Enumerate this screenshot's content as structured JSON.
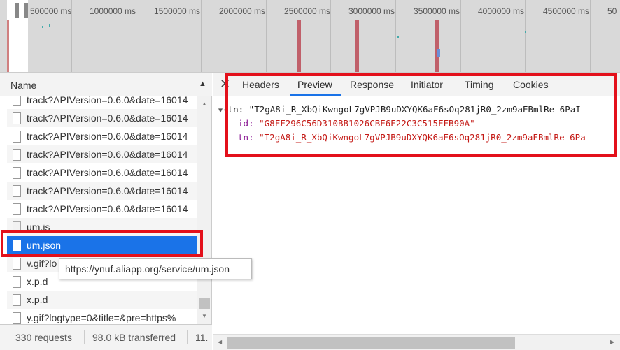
{
  "timeline": {
    "ticks": [
      "500000 ms",
      "1000000 ms",
      "1500000 ms",
      "2000000 ms",
      "2500000 ms",
      "3000000 ms",
      "3500000 ms",
      "4000000 ms",
      "4500000 ms",
      "50"
    ]
  },
  "requests_panel": {
    "header": {
      "name_column": "Name"
    },
    "items": [
      {
        "name": "track?APIVersion=0.6.0&date=16014",
        "icon": "document-icon"
      },
      {
        "name": "track?APIVersion=0.6.0&date=16014",
        "icon": "document-icon"
      },
      {
        "name": "track?APIVersion=0.6.0&date=16014",
        "icon": "document-icon"
      },
      {
        "name": "track?APIVersion=0.6.0&date=16014",
        "icon": "document-icon"
      },
      {
        "name": "track?APIVersion=0.6.0&date=16014",
        "icon": "document-icon"
      },
      {
        "name": "track?APIVersion=0.6.0&date=16014",
        "icon": "document-icon"
      },
      {
        "name": "track?APIVersion=0.6.0&date=16014",
        "icon": "document-icon"
      },
      {
        "name": "um.js",
        "icon": "script-icon"
      },
      {
        "name": "um.json",
        "icon": "document-icon",
        "selected": true
      },
      {
        "name": "v.gif?lo",
        "icon": "document-icon"
      },
      {
        "name": "x.p.d",
        "icon": "document-icon"
      },
      {
        "name": "x.p.d",
        "icon": "document-icon"
      },
      {
        "name": "y.gif?logtype=0&title=&pre=https%",
        "icon": "document-icon"
      }
    ],
    "tooltip": "https://ynuf.aliapp.org/service/um.json",
    "status": {
      "requests": "330 requests",
      "transferred": "98.0 kB transferred",
      "extra": "11."
    }
  },
  "details_panel": {
    "tabs": [
      "Headers",
      "Preview",
      "Response",
      "Initiator",
      "Timing",
      "Cookies"
    ],
    "active_tab": "Preview",
    "preview": {
      "summary_prefix": "{tn: ",
      "summary_value": "\"T2gA8i_R_XbQiKwngoL7gVPJB9uDXYQK6aE6sOq281jR0_2zm9aEBmlRe-6PaI",
      "fields": [
        {
          "key": "id",
          "value": "\"G8FF296C56D310BB1026CBE6E22C3C515FFB90A\""
        },
        {
          "key": "tn",
          "value": "\"T2gA8i_R_XbQiKwngoL7gVPJB9uDXYQK6aE6sOq281jR0_2zm9aEBmlRe-6Pa"
        }
      ]
    }
  },
  "colors": {
    "highlight": "#e3101b",
    "selection": "#1a73e8",
    "json_key": "#881391",
    "json_string": "#c41a16"
  }
}
